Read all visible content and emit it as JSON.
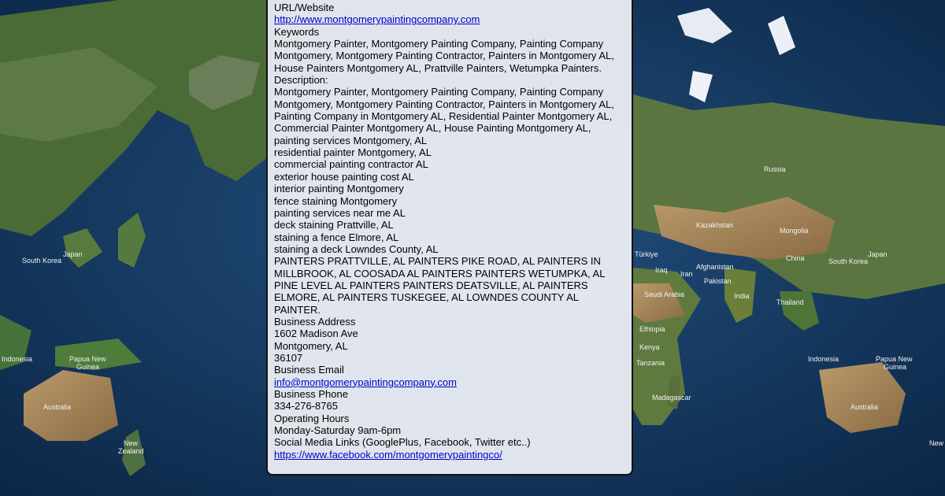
{
  "colors": {
    "ocean": "#0f2f55",
    "land": "#4b6b32",
    "card_bg": "#f0f2f8",
    "link": "#0000cc"
  },
  "map_labels": {
    "left": [
      "Japan",
      "South Korea",
      "Indonesia",
      "Papua New Guinea",
      "Australia",
      "New Zealand"
    ],
    "right": [
      "Russia",
      "Kazakhstan",
      "Mongolia",
      "Türkiye",
      "China",
      "South Korea",
      "Japan",
      "Iraq",
      "Iran",
      "Afghanistan",
      "Pakistan",
      "Saudi Arabia",
      "India",
      "Thailand",
      "Ethiopia",
      "Kenya",
      "Tanzania",
      "Madagascar",
      "Indonesia",
      "Papua New Guinea",
      "Australia",
      "New"
    ]
  },
  "listing": {
    "url_label": "URL/Website",
    "url": "http://www.montgomerypaintingcompany.com",
    "keywords_label": "Keywords",
    "keywords": "Montgomery Painter, Montgomery Painting Company, Painting Company Montgomery, Montgomery Painting Contractor, Painters in Montgomery AL, House Painters Montgomery AL, Prattville Painters, Wetumpka Painters.",
    "description_label": "Description:",
    "description_intro": "Montgomery Painter, Montgomery Painting Company, Painting Company Montgomery, Montgomery Painting Contractor, Painters in Montgomery AL, Painting Company in Montgomery AL, Residential Painter Montgomery AL, Commercial Painter Montgomery AL, House Painting Montgomery AL,",
    "description_lines": [
      "painting services Montgomery, AL",
      "residential painter Montgomery, AL",
      "commercial painting contractor AL",
      "exterior house painting cost AL",
      "interior painting Montgomery",
      "fence staining Montgomery",
      "painting services near me AL",
      "deck staining Prattville, AL",
      "staining a fence Elmore, AL",
      "staining a deck Lowndes County, AL"
    ],
    "description_caps": "PAINTERS PRATTVILLE, AL PAINTERS PIKE ROAD, AL PAINTERS IN MILLBROOK, AL COOSADA AL PAINTERS PAINTERS WETUMPKA, AL PINE LEVEL AL PAINTERS PAINTERS DEATSVILLE, AL PAINTERS ELMORE, AL PAINTERS TUSKEGEE, AL LOWNDES COUNTY AL PAINTER.",
    "address_label": "Business Address",
    "address_street": "1602 Madison Ave",
    "address_city": "Montgomery, AL",
    "address_zip": "36107",
    "email_label": "Business Email",
    "email": "info@montgomerypaintingcompany.com",
    "phone_label": "Business Phone",
    "phone": "334-276-8765",
    "hours_label": "Operating Hours",
    "hours": "Monday-Saturday 9am-6pm",
    "social_label": "Social Media Links (GooglePlus, Facebook, Twitter etc..)",
    "social_url": "https://www.facebook.com/montgomerypaintingco/"
  }
}
